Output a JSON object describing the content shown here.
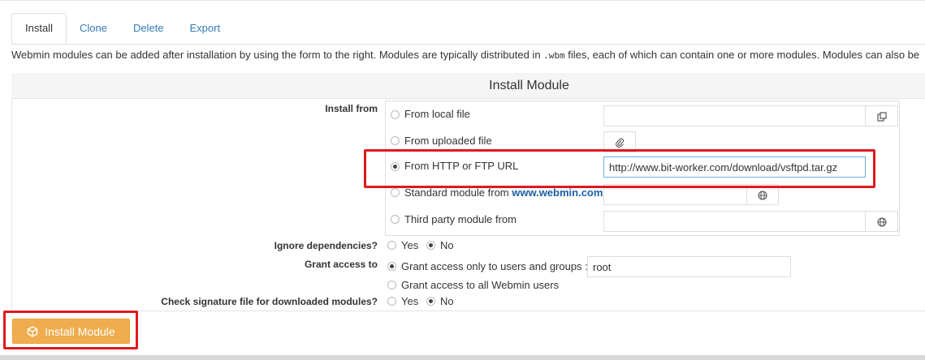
{
  "tabs": [
    {
      "label": "Install",
      "active": true
    },
    {
      "label": "Clone",
      "active": false
    },
    {
      "label": "Delete",
      "active": false
    },
    {
      "label": "Export",
      "active": false
    }
  ],
  "description": {
    "before": "Webmin modules can be added after installation by using the form to the right. Modules are typically distributed in ",
    "code": ".wbm",
    "after": " files, each of which can contain one or more modules. Modules can also be"
  },
  "panel": {
    "title": "Install Module"
  },
  "install_from": {
    "label": "Install from",
    "options": [
      {
        "label": "From local file",
        "selected": false,
        "value": ""
      },
      {
        "label": "From uploaded file",
        "selected": false
      },
      {
        "label": "From HTTP or FTP URL",
        "selected": true,
        "value": "http://www.bit-worker.com/download/vsftpd.tar.gz"
      },
      {
        "label": "Standard module from ",
        "link": "www.webmin.com",
        "selected": false,
        "value": ""
      },
      {
        "label": "Third party module from",
        "selected": false,
        "value": ""
      }
    ]
  },
  "ignore_deps": {
    "label": "Ignore dependencies?",
    "yes": "Yes",
    "no": "No",
    "selected": "No"
  },
  "grant_access": {
    "label": "Grant access to",
    "option_users": "Grant access only to users and groups :",
    "users_value": "root",
    "option_all": "Grant access to all Webmin users"
  },
  "check_sig": {
    "label": "Check signature file for downloaded modules?",
    "yes": "Yes",
    "no": "No",
    "selected": "No"
  },
  "submit": {
    "label": "Install Module"
  },
  "icons": {
    "file_chooser": "copy-icon",
    "upload": "paperclip-icon",
    "globe": "globe-icon",
    "cube": "cube-icon"
  },
  "colors": {
    "highlight": "#e0191f",
    "button": "#f0ad4e",
    "link": "#337ab7"
  }
}
